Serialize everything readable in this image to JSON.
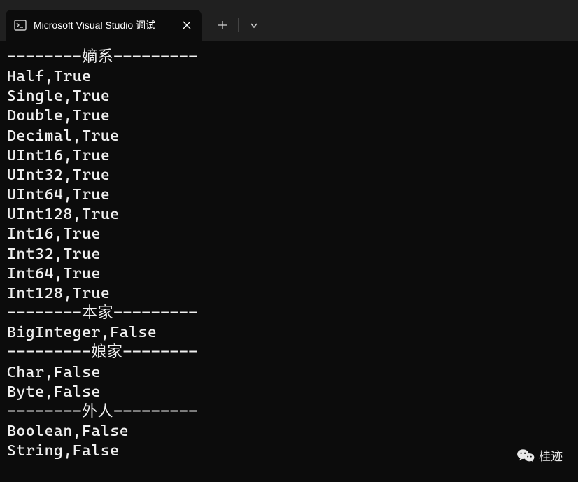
{
  "tab": {
    "title": "Microsoft Visual Studio 调试"
  },
  "terminal": {
    "lines": [
      "--------嫡系---------",
      "Half,True",
      "Single,True",
      "Double,True",
      "Decimal,True",
      "UInt16,True",
      "UInt32,True",
      "UInt64,True",
      "UInt128,True",
      "Int16,True",
      "Int32,True",
      "Int64,True",
      "Int128,True",
      "--------本家---------",
      "BigInteger,False",
      "---------娘家--------",
      "Char,False",
      "Byte,False",
      "--------外人---------",
      "Boolean,False",
      "String,False"
    ]
  },
  "watermark": {
    "text": "桂迹"
  }
}
